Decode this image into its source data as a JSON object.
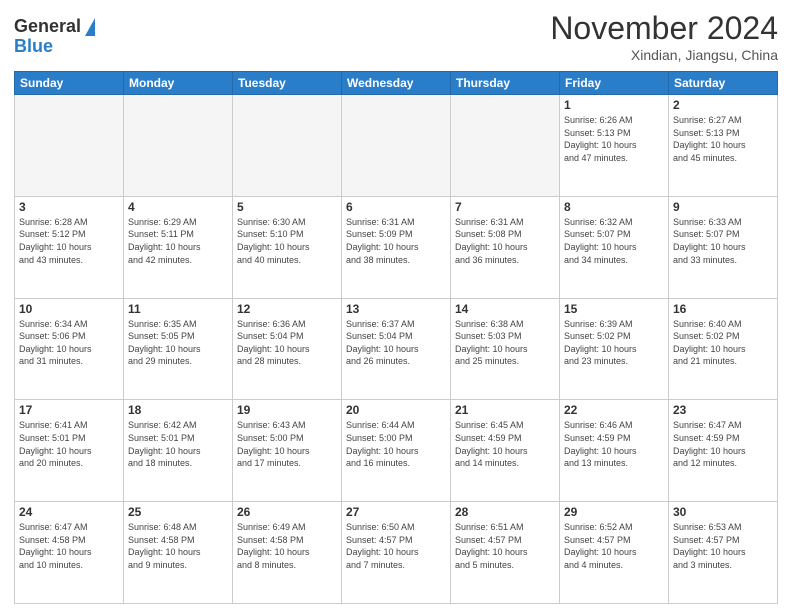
{
  "header": {
    "logo_line1": "General",
    "logo_line2": "Blue",
    "month_title": "November 2024",
    "location": "Xindian, Jiangsu, China"
  },
  "weekdays": [
    "Sunday",
    "Monday",
    "Tuesday",
    "Wednesday",
    "Thursday",
    "Friday",
    "Saturday"
  ],
  "weeks": [
    [
      {
        "day": "",
        "info": ""
      },
      {
        "day": "",
        "info": ""
      },
      {
        "day": "",
        "info": ""
      },
      {
        "day": "",
        "info": ""
      },
      {
        "day": "",
        "info": ""
      },
      {
        "day": "1",
        "info": "Sunrise: 6:26 AM\nSunset: 5:13 PM\nDaylight: 10 hours\nand 47 minutes."
      },
      {
        "day": "2",
        "info": "Sunrise: 6:27 AM\nSunset: 5:13 PM\nDaylight: 10 hours\nand 45 minutes."
      }
    ],
    [
      {
        "day": "3",
        "info": "Sunrise: 6:28 AM\nSunset: 5:12 PM\nDaylight: 10 hours\nand 43 minutes."
      },
      {
        "day": "4",
        "info": "Sunrise: 6:29 AM\nSunset: 5:11 PM\nDaylight: 10 hours\nand 42 minutes."
      },
      {
        "day": "5",
        "info": "Sunrise: 6:30 AM\nSunset: 5:10 PM\nDaylight: 10 hours\nand 40 minutes."
      },
      {
        "day": "6",
        "info": "Sunrise: 6:31 AM\nSunset: 5:09 PM\nDaylight: 10 hours\nand 38 minutes."
      },
      {
        "day": "7",
        "info": "Sunrise: 6:31 AM\nSunset: 5:08 PM\nDaylight: 10 hours\nand 36 minutes."
      },
      {
        "day": "8",
        "info": "Sunrise: 6:32 AM\nSunset: 5:07 PM\nDaylight: 10 hours\nand 34 minutes."
      },
      {
        "day": "9",
        "info": "Sunrise: 6:33 AM\nSunset: 5:07 PM\nDaylight: 10 hours\nand 33 minutes."
      }
    ],
    [
      {
        "day": "10",
        "info": "Sunrise: 6:34 AM\nSunset: 5:06 PM\nDaylight: 10 hours\nand 31 minutes."
      },
      {
        "day": "11",
        "info": "Sunrise: 6:35 AM\nSunset: 5:05 PM\nDaylight: 10 hours\nand 29 minutes."
      },
      {
        "day": "12",
        "info": "Sunrise: 6:36 AM\nSunset: 5:04 PM\nDaylight: 10 hours\nand 28 minutes."
      },
      {
        "day": "13",
        "info": "Sunrise: 6:37 AM\nSunset: 5:04 PM\nDaylight: 10 hours\nand 26 minutes."
      },
      {
        "day": "14",
        "info": "Sunrise: 6:38 AM\nSunset: 5:03 PM\nDaylight: 10 hours\nand 25 minutes."
      },
      {
        "day": "15",
        "info": "Sunrise: 6:39 AM\nSunset: 5:02 PM\nDaylight: 10 hours\nand 23 minutes."
      },
      {
        "day": "16",
        "info": "Sunrise: 6:40 AM\nSunset: 5:02 PM\nDaylight: 10 hours\nand 21 minutes."
      }
    ],
    [
      {
        "day": "17",
        "info": "Sunrise: 6:41 AM\nSunset: 5:01 PM\nDaylight: 10 hours\nand 20 minutes."
      },
      {
        "day": "18",
        "info": "Sunrise: 6:42 AM\nSunset: 5:01 PM\nDaylight: 10 hours\nand 18 minutes."
      },
      {
        "day": "19",
        "info": "Sunrise: 6:43 AM\nSunset: 5:00 PM\nDaylight: 10 hours\nand 17 minutes."
      },
      {
        "day": "20",
        "info": "Sunrise: 6:44 AM\nSunset: 5:00 PM\nDaylight: 10 hours\nand 16 minutes."
      },
      {
        "day": "21",
        "info": "Sunrise: 6:45 AM\nSunset: 4:59 PM\nDaylight: 10 hours\nand 14 minutes."
      },
      {
        "day": "22",
        "info": "Sunrise: 6:46 AM\nSunset: 4:59 PM\nDaylight: 10 hours\nand 13 minutes."
      },
      {
        "day": "23",
        "info": "Sunrise: 6:47 AM\nSunset: 4:59 PM\nDaylight: 10 hours\nand 12 minutes."
      }
    ],
    [
      {
        "day": "24",
        "info": "Sunrise: 6:47 AM\nSunset: 4:58 PM\nDaylight: 10 hours\nand 10 minutes."
      },
      {
        "day": "25",
        "info": "Sunrise: 6:48 AM\nSunset: 4:58 PM\nDaylight: 10 hours\nand 9 minutes."
      },
      {
        "day": "26",
        "info": "Sunrise: 6:49 AM\nSunset: 4:58 PM\nDaylight: 10 hours\nand 8 minutes."
      },
      {
        "day": "27",
        "info": "Sunrise: 6:50 AM\nSunset: 4:57 PM\nDaylight: 10 hours\nand 7 minutes."
      },
      {
        "day": "28",
        "info": "Sunrise: 6:51 AM\nSunset: 4:57 PM\nDaylight: 10 hours\nand 5 minutes."
      },
      {
        "day": "29",
        "info": "Sunrise: 6:52 AM\nSunset: 4:57 PM\nDaylight: 10 hours\nand 4 minutes."
      },
      {
        "day": "30",
        "info": "Sunrise: 6:53 AM\nSunset: 4:57 PM\nDaylight: 10 hours\nand 3 minutes."
      }
    ]
  ]
}
